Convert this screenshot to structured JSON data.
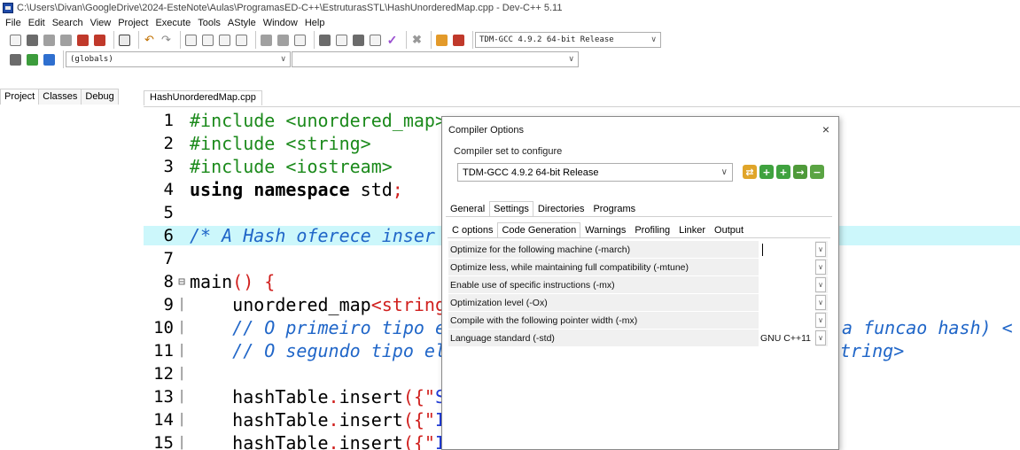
{
  "window": {
    "title": "C:\\Users\\Divan\\GoogleDrive\\2024-EsteNote\\Aulas\\ProgramasED-C++\\EstruturasSTL\\HashUnorderedMap.cpp - Dev-C++ 5.11"
  },
  "menu": [
    "File",
    "Edit",
    "Search",
    "View",
    "Project",
    "Execute",
    "Tools",
    "AStyle",
    "Window",
    "Help"
  ],
  "toolbar": {
    "compiler_select": "TDM-GCC 4.9.2 64-bit Release",
    "scope_select": "(globals)",
    "symbol_select": ""
  },
  "left_tabs": [
    "Project",
    "Classes",
    "Debug"
  ],
  "editor": {
    "file_tab": "HashUnorderedMap.cpp",
    "lines": [
      {
        "n": "1",
        "text": "#include <unordered_map>"
      },
      {
        "n": "2",
        "text": "#include <string>"
      },
      {
        "n": "3",
        "text": "#include <iostream>"
      },
      {
        "n": "4",
        "kw": "using namespace",
        "rest": " std",
        "semi": ";"
      },
      {
        "n": "5",
        "text": ""
      },
      {
        "n": "6",
        "text": "/* A Hash oferece inser"
      },
      {
        "n": "7",
        "text": ""
      },
      {
        "n": "8",
        "name": "main",
        "paren": "() {"
      },
      {
        "n": "9",
        "indent": "    ",
        "text": "unordered_map",
        "lt": "<string"
      },
      {
        "n": "10",
        "text": "    // O primeiro tipo e",
        "tail": "a funcao hash) <"
      },
      {
        "n": "11",
        "text": "    // O segundo tipo el",
        "tail": "tring>"
      },
      {
        "n": "12",
        "text": ""
      },
      {
        "n": "13",
        "obj": "    hashTable",
        "dot": ".",
        "fn": "insert",
        "open": "({\"",
        "strfrag": "S"
      },
      {
        "n": "14",
        "obj": "    hashTable",
        "dot": ".",
        "fn": "insert",
        "open": "({\"",
        "strfrag": "I"
      },
      {
        "n": "15",
        "obj": "    hashTable",
        "dot": ".",
        "fn": "insert",
        "open": "({\"",
        "strfrag": "I"
      }
    ]
  },
  "dialog": {
    "title": "Compiler Options",
    "close": "×",
    "group_label": "Compiler set to configure",
    "compiler_set": "TDM-GCC 4.9.2 64-bit Release",
    "tabs": [
      "General",
      "Settings",
      "Directories",
      "Programs"
    ],
    "active_tab": "Settings",
    "subtabs": [
      "C options",
      "Code Generation",
      "Warnings",
      "Profiling",
      "Linker",
      "Output"
    ],
    "active_subtab": "Code Generation",
    "options": [
      {
        "label": "Optimize for the following machine (-march)",
        "value": ""
      },
      {
        "label": "Optimize less, while maintaining full compatibility (-mtune)",
        "value": ""
      },
      {
        "label": "Enable use of specific instructions (-mx)",
        "value": ""
      },
      {
        "label": "Optimization level (-Ox)",
        "value": ""
      },
      {
        "label": "Compile with the following pointer width (-mx)",
        "value": ""
      },
      {
        "label": "Language standard (-std)",
        "value": "GNU C++11"
      }
    ]
  }
}
